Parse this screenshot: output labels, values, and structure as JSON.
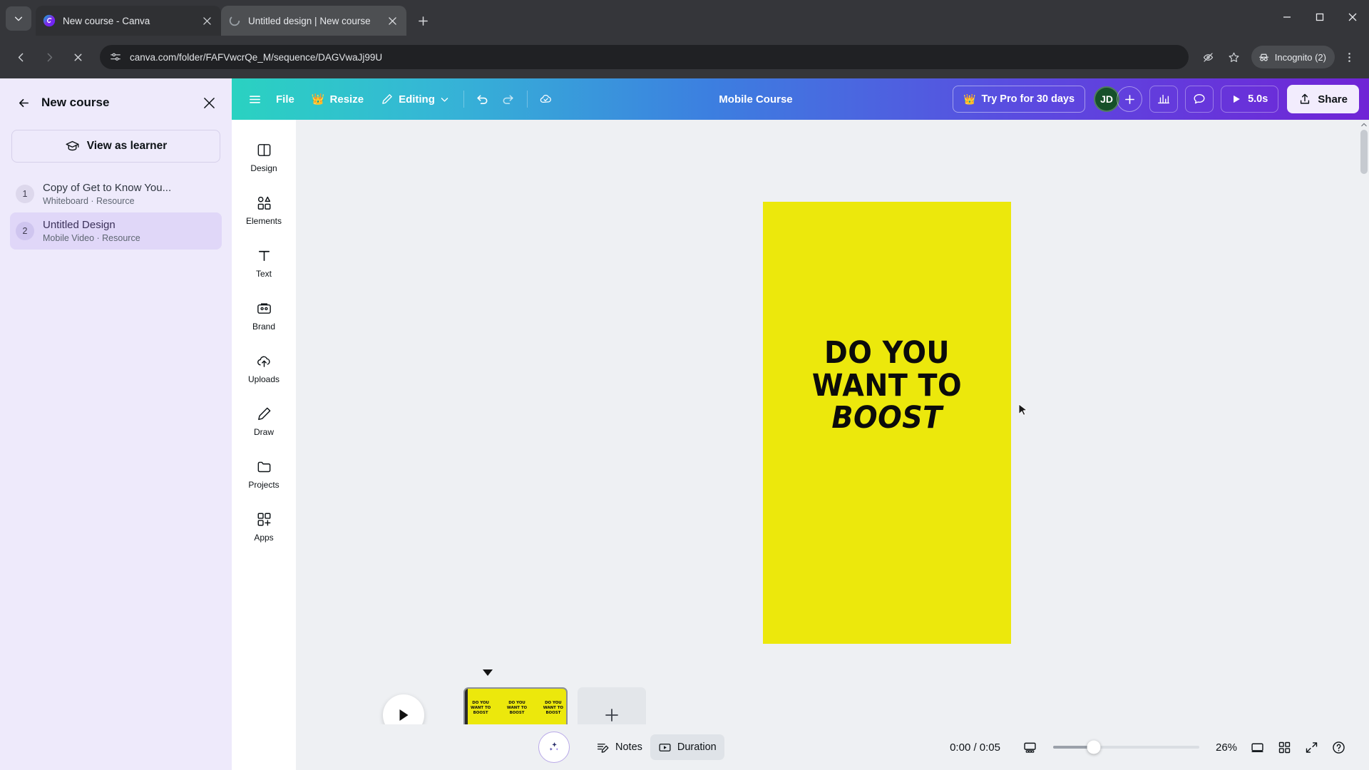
{
  "browser": {
    "tabs": [
      {
        "title": "New course - Canva",
        "active": false,
        "favicon": "canva-icon"
      },
      {
        "title": "Untitled design | New course",
        "active": true,
        "favicon": "canva-icon"
      }
    ],
    "new_tab_label": "+",
    "url": "canva.com/folder/FAFVwcrQe_M/sequence/DAGVwaJj99U",
    "profile_label": "Incognito (2)",
    "icons": {
      "tab_list": "chevron-down-icon",
      "back": "back-arrow-icon",
      "forward": "forward-arrow-icon",
      "stop": "stop-loading-icon",
      "site_settings": "site-settings-icon",
      "hide_password": "eye-off-icon",
      "bookmark": "star-icon",
      "incognito": "incognito-icon",
      "menu": "three-dot-menu-icon",
      "minimize": "minimize-icon",
      "maximize": "maximize-icon",
      "close": "close-icon"
    }
  },
  "course_panel": {
    "title": "New course",
    "view_as_learner": "View as learner",
    "lessons": [
      {
        "num": "1",
        "title": "Copy of Get to Know You...",
        "subtitle": "Whiteboard · Resource",
        "selected": false
      },
      {
        "num": "2",
        "title": "Untitled Design",
        "subtitle": "Mobile Video · Resource",
        "selected": true
      }
    ]
  },
  "toolbar": {
    "menu_label": "",
    "file_label": "File",
    "resize_label": "Resize",
    "editing_label": "Editing",
    "design_name": "Mobile Course",
    "try_pro_label": "Try Pro for 30 days",
    "avatar_initials": "JD",
    "play_duration": "5.0s",
    "share_label": "Share",
    "colors": {
      "gradient_start": "#2ad2c1",
      "gradient_mid": "#3c7fe0",
      "gradient_end": "#7024d6",
      "avatar_bg": "#16502a",
      "share_bg": "#f2ecfd"
    }
  },
  "tool_rail": [
    {
      "label": "Design",
      "icon": "design-icon"
    },
    {
      "label": "Elements",
      "icon": "elements-icon"
    },
    {
      "label": "Text",
      "icon": "text-icon"
    },
    {
      "label": "Brand",
      "icon": "brand-icon"
    },
    {
      "label": "Uploads",
      "icon": "uploads-icon"
    },
    {
      "label": "Draw",
      "icon": "draw-icon"
    },
    {
      "label": "Projects",
      "icon": "projects-icon"
    },
    {
      "label": "Apps",
      "icon": "apps-icon"
    }
  ],
  "canvas": {
    "background_color": "#ece80c",
    "lines": [
      "DO YOU",
      "WANT TO",
      "BOOST"
    ]
  },
  "timeline": {
    "scene_duration": "5.0s",
    "thumb_lines": [
      "DO YOU",
      "WANT TO",
      "BOOST"
    ],
    "add_scene_label": "+"
  },
  "statusbar": {
    "notes_label": "Notes",
    "duration_label": "Duration",
    "time_readout": "0:00 / 0:05",
    "zoom_percent": "26%",
    "icons": {
      "magic": "magic-sparkle-icon",
      "notes": "notes-edit-icon",
      "duration": "duration-play-icon",
      "page_view": "page-view-icon",
      "fit_screen": "fit-screen-icon",
      "grid_view": "grid-view-icon",
      "fullscreen": "fullscreen-icon",
      "help": "help-icon"
    }
  }
}
